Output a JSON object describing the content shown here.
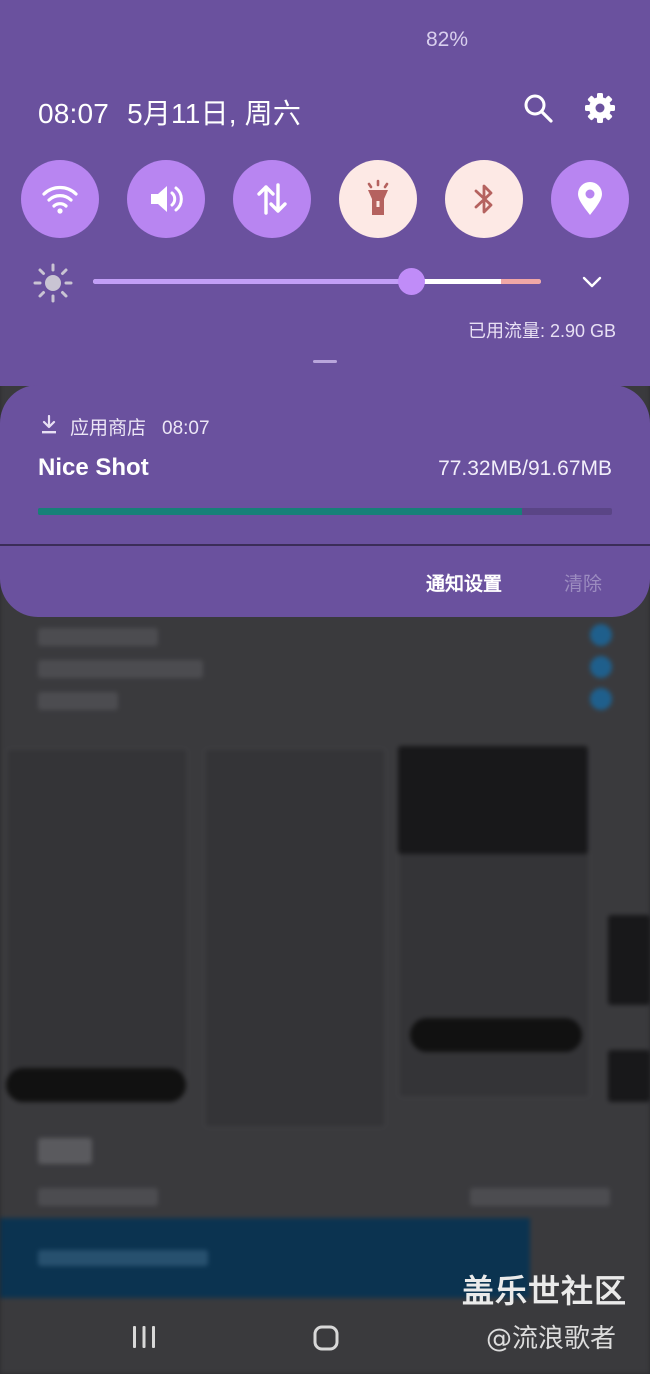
{
  "status_bar": {
    "battery": "82%"
  },
  "header": {
    "time": "08:07",
    "date": "5月11日, 周六"
  },
  "quick_settings": [
    {
      "name": "wifi",
      "on": false
    },
    {
      "name": "sound",
      "on": false
    },
    {
      "name": "mobile-data",
      "on": false
    },
    {
      "name": "flashlight",
      "on": true
    },
    {
      "name": "bluetooth",
      "on": true
    },
    {
      "name": "location",
      "on": false
    }
  ],
  "brightness": {
    "level": 0.71
  },
  "data_usage": "已用流量: 2.90 GB",
  "notification": {
    "app": "应用商店",
    "time": "08:07",
    "title": "Nice Shot",
    "progress_text": "77.32MB/91.67MB",
    "progress": 0.843,
    "settings_label": "通知设置",
    "clear_label": "清除"
  },
  "colors": {
    "panel": "#6a519e",
    "tile_off": "#b885f1",
    "tile_on": "#fde9e5",
    "progress": "#178078"
  },
  "watermark": {
    "main": "盖乐世社区",
    "sub": "@流浪歌者"
  }
}
